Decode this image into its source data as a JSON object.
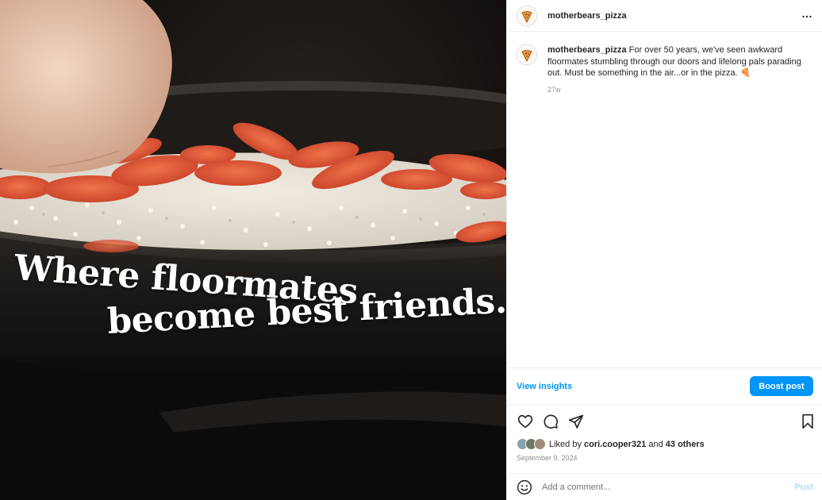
{
  "post": {
    "image_text_line1": "Where floormates",
    "image_text_line2": "become best friends.",
    "username": "motherbears_pizza",
    "more_icon": "…"
  },
  "caption": {
    "username": "motherbears_pizza",
    "text": "For over 50 years, we've seen awkward floormates stumbling through our doors and lifelong pals parading out. Must be something in the air...or in the pizza.",
    "emoji": "🍕",
    "time": "27w"
  },
  "insights": {
    "link_label": "View insights",
    "boost_label": "Boost post"
  },
  "actions": {
    "icons": [
      "heart-icon",
      "comment-icon",
      "share-icon",
      "bookmark-icon"
    ]
  },
  "likes": {
    "prefix": "Liked by",
    "liker": "cori.cooper321",
    "joiner": "and",
    "others": "43 others"
  },
  "date": "September 9, 2024",
  "comment": {
    "placeholder": "Add a comment...",
    "post_label": "Post"
  },
  "colors": {
    "accent": "#0095f6",
    "post_disabled": "#b2dffc"
  }
}
